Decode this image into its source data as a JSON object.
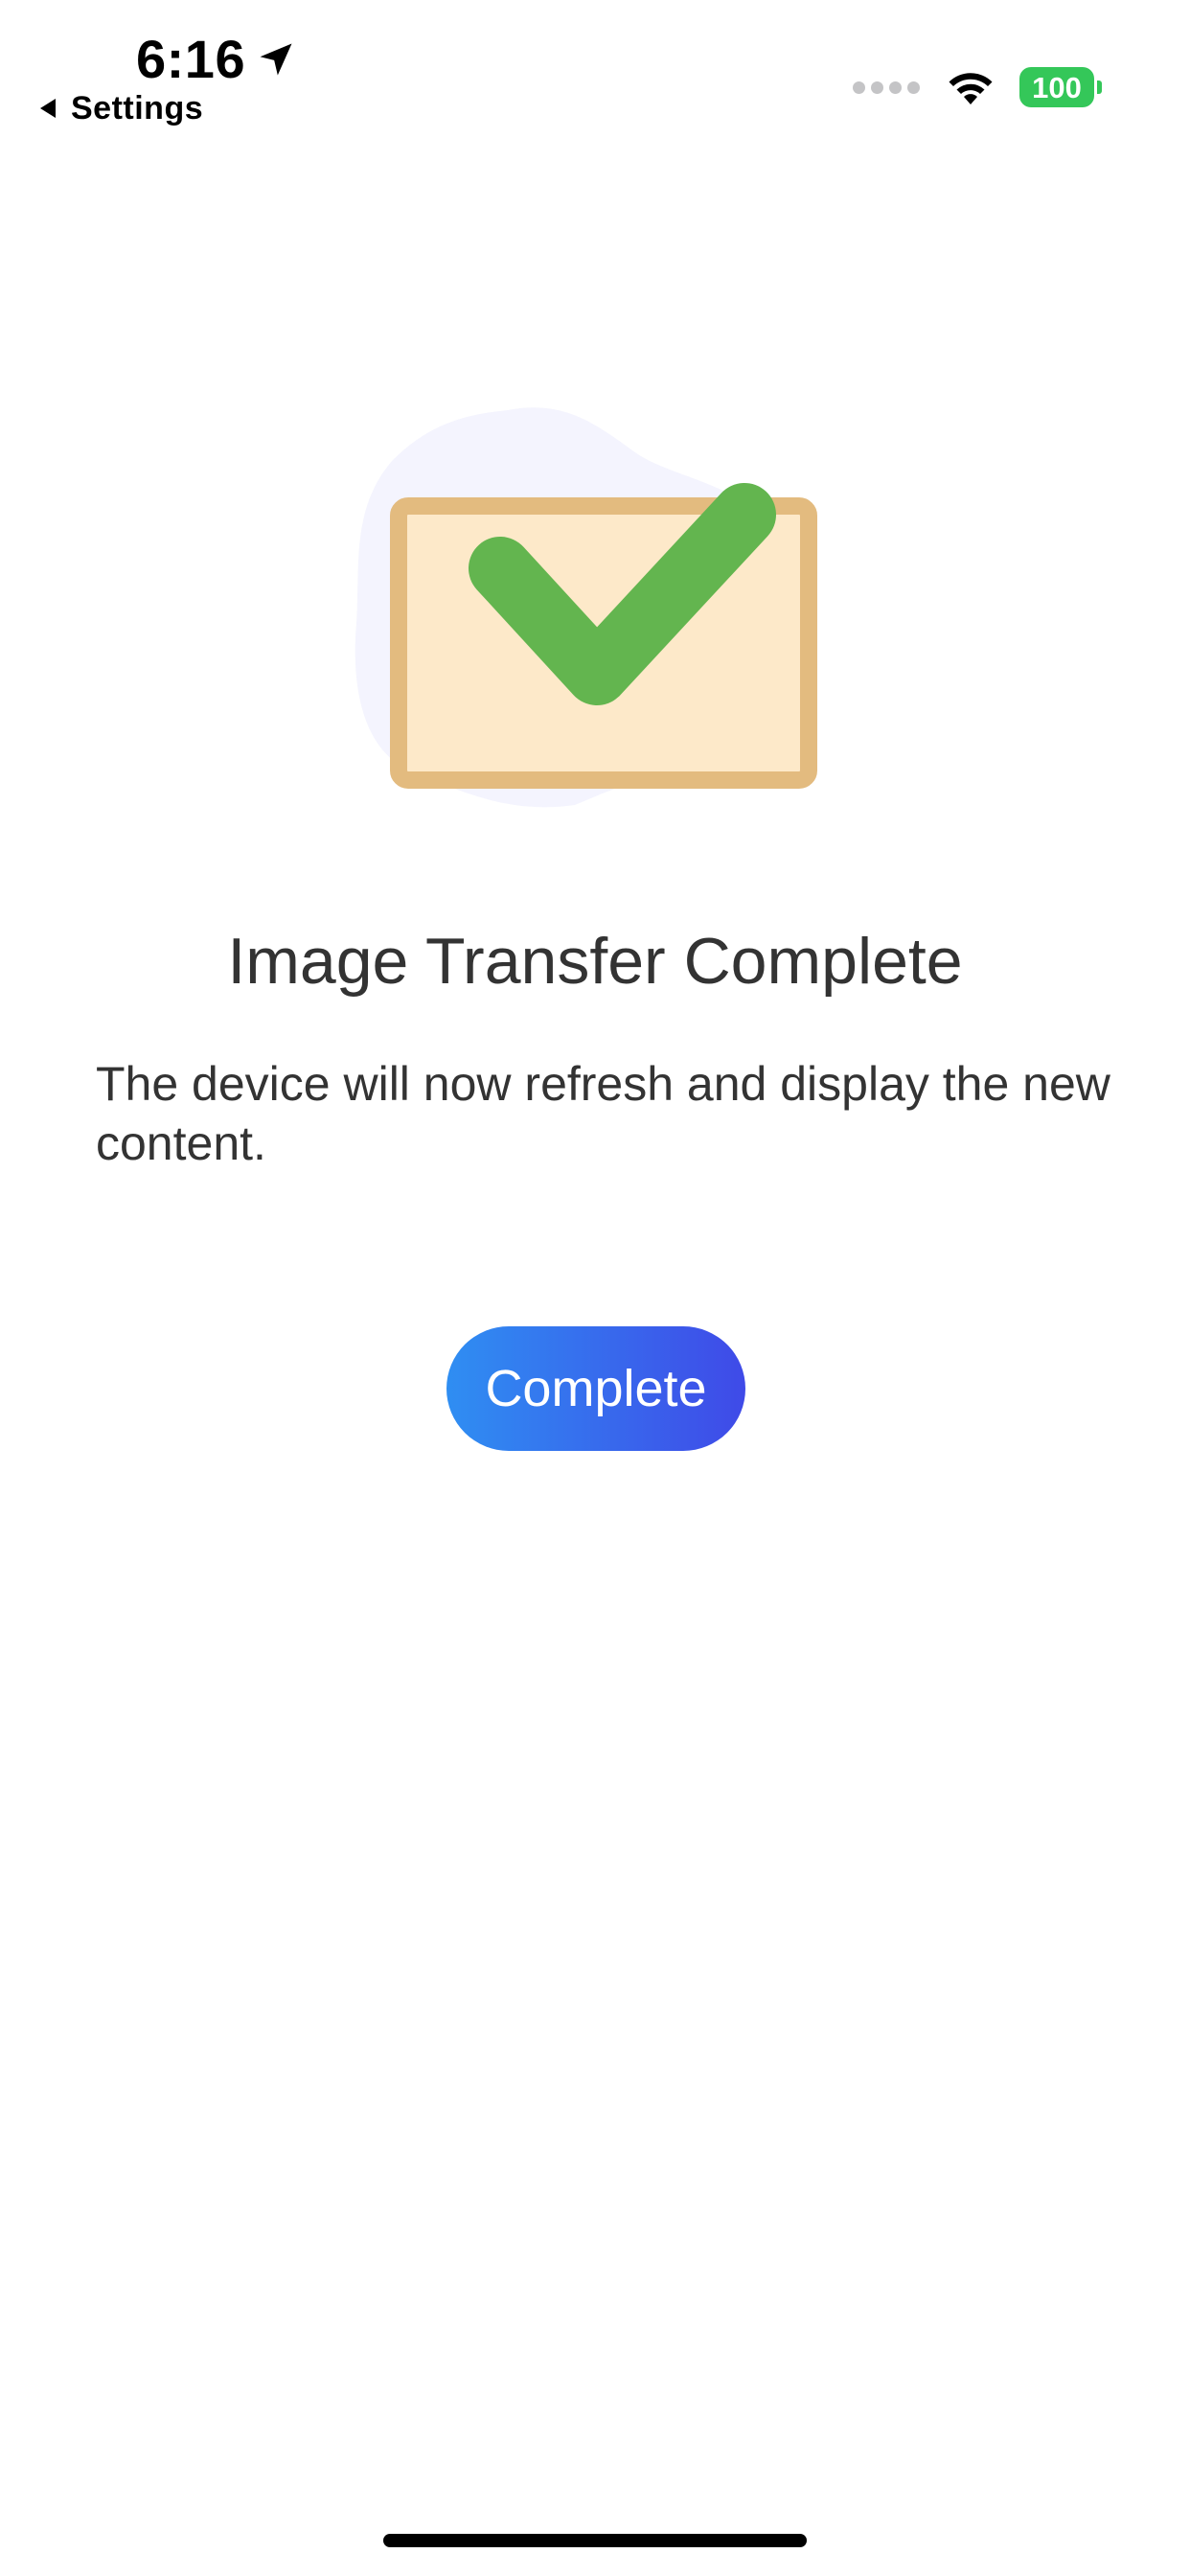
{
  "status_bar": {
    "time": "6:16",
    "back_label": "Settings",
    "battery_level": "100",
    "icons": [
      "location-arrow-icon",
      "signal-dots-icon",
      "wifi-icon",
      "battery-icon"
    ],
    "battery_color": "#34c759"
  },
  "illustration": {
    "icons": [
      "image-frame-icon",
      "checkmark-icon"
    ],
    "frame_fill": "#fde9c9",
    "frame_border": "#e3bb7f",
    "check_color": "#63b54f",
    "blob_color": "#f4f4fe"
  },
  "content": {
    "title": "Image Transfer Complete",
    "message": "The device will now refresh and display the new content."
  },
  "actions": {
    "complete_label": "Complete",
    "button_gradient": [
      "#2f8ef2",
      "#3f4ae8"
    ]
  }
}
